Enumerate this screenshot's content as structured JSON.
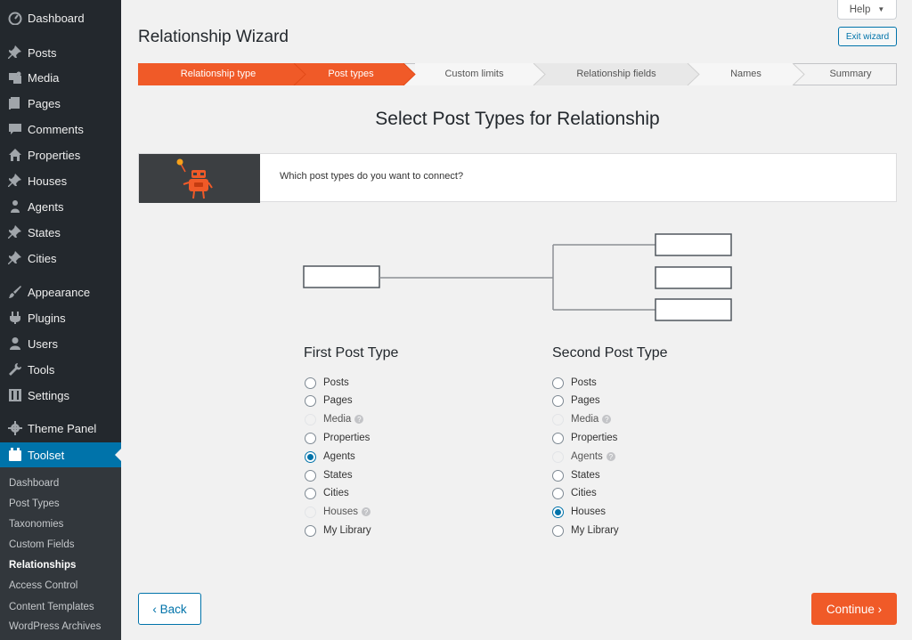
{
  "sidebar": {
    "items": [
      {
        "label": "Dashboard",
        "icon": "dashboard-icon"
      },
      {
        "label": "Posts",
        "icon": "pin-icon"
      },
      {
        "label": "Media",
        "icon": "media-icon"
      },
      {
        "label": "Pages",
        "icon": "pages-icon"
      },
      {
        "label": "Comments",
        "icon": "comment-icon"
      },
      {
        "label": "Properties",
        "icon": "home-icon"
      },
      {
        "label": "Houses",
        "icon": "pin-icon"
      },
      {
        "label": "Agents",
        "icon": "users-icon"
      },
      {
        "label": "States",
        "icon": "pin-icon"
      },
      {
        "label": "Cities",
        "icon": "pin-icon"
      },
      {
        "label": "Appearance",
        "icon": "brush-icon"
      },
      {
        "label": "Plugins",
        "icon": "plugin-icon"
      },
      {
        "label": "Users",
        "icon": "user-icon"
      },
      {
        "label": "Tools",
        "icon": "wrench-icon"
      },
      {
        "label": "Settings",
        "icon": "settings-icon"
      },
      {
        "label": "Theme Panel",
        "icon": "gear-icon"
      },
      {
        "label": "Toolset",
        "icon": "toolset-icon"
      }
    ],
    "submenu": [
      {
        "label": "Dashboard"
      },
      {
        "label": "Post Types"
      },
      {
        "label": "Taxonomies"
      },
      {
        "label": "Custom Fields"
      },
      {
        "label": "Relationships"
      },
      {
        "label": "Access Control"
      },
      {
        "label": "Content Templates"
      },
      {
        "label": "WordPress Archives"
      }
    ]
  },
  "header": {
    "help_label": "Help",
    "exit_label": "Exit wizard",
    "title": "Relationship Wizard"
  },
  "steps": [
    {
      "label": "Relationship type",
      "state": "done"
    },
    {
      "label": "Post types",
      "state": "current"
    },
    {
      "label": "Custom limits",
      "state": "todo"
    },
    {
      "label": "Relationship fields",
      "state": "todo"
    },
    {
      "label": "Names",
      "state": "todo"
    },
    {
      "label": "Summary",
      "state": "todo"
    }
  ],
  "main": {
    "heading": "Select Post Types for Relationship",
    "intro": "Which post types do you want to connect?",
    "first": {
      "title": "First Post Type",
      "options": [
        {
          "label": "Posts",
          "checked": false,
          "disabled": false,
          "help": false
        },
        {
          "label": "Pages",
          "checked": false,
          "disabled": false,
          "help": false
        },
        {
          "label": "Media",
          "checked": false,
          "disabled": true,
          "help": true
        },
        {
          "label": "Properties",
          "checked": false,
          "disabled": false,
          "help": false
        },
        {
          "label": "Agents",
          "checked": true,
          "disabled": false,
          "help": false
        },
        {
          "label": "States",
          "checked": false,
          "disabled": false,
          "help": false
        },
        {
          "label": "Cities",
          "checked": false,
          "disabled": false,
          "help": false
        },
        {
          "label": "Houses",
          "checked": false,
          "disabled": true,
          "help": true
        },
        {
          "label": "My Library",
          "checked": false,
          "disabled": false,
          "help": false
        }
      ]
    },
    "second": {
      "title": "Second Post Type",
      "options": [
        {
          "label": "Posts",
          "checked": false,
          "disabled": false,
          "help": false
        },
        {
          "label": "Pages",
          "checked": false,
          "disabled": false,
          "help": false
        },
        {
          "label": "Media",
          "checked": false,
          "disabled": true,
          "help": true
        },
        {
          "label": "Properties",
          "checked": false,
          "disabled": false,
          "help": false
        },
        {
          "label": "Agents",
          "checked": false,
          "disabled": true,
          "help": true
        },
        {
          "label": "States",
          "checked": false,
          "disabled": false,
          "help": false
        },
        {
          "label": "Cities",
          "checked": false,
          "disabled": false,
          "help": false
        },
        {
          "label": "Houses",
          "checked": true,
          "disabled": false,
          "help": false
        },
        {
          "label": "My Library",
          "checked": false,
          "disabled": false,
          "help": false
        }
      ]
    },
    "help_mark": "?"
  },
  "footer": {
    "back_label": "‹ Back",
    "continue_label": "Continue ›"
  },
  "colors": {
    "accent": "#f05a28",
    "link": "#0073aa",
    "sidebar": "#23282d",
    "sidebar_active": "#0073aa"
  }
}
